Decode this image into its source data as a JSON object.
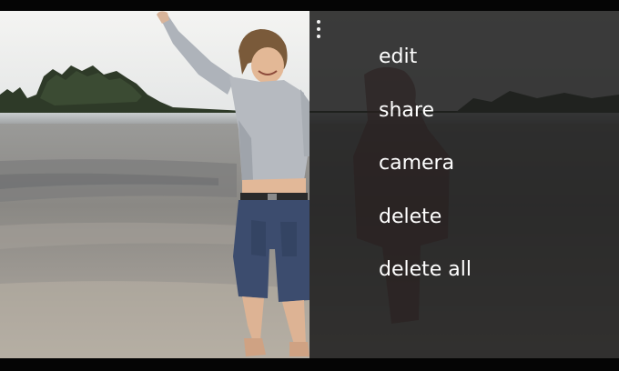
{
  "app_bar": {
    "more_icon": "ellipsis-vertical-icon",
    "menu_items": [
      {
        "label": "edit"
      },
      {
        "label": "share"
      },
      {
        "label": "camera"
      },
      {
        "label": "delete"
      },
      {
        "label": "delete all"
      }
    ]
  },
  "colors": {
    "overlay": "#1c1c1c",
    "menu_text": "#ffffff",
    "letterbox": "#050505"
  }
}
